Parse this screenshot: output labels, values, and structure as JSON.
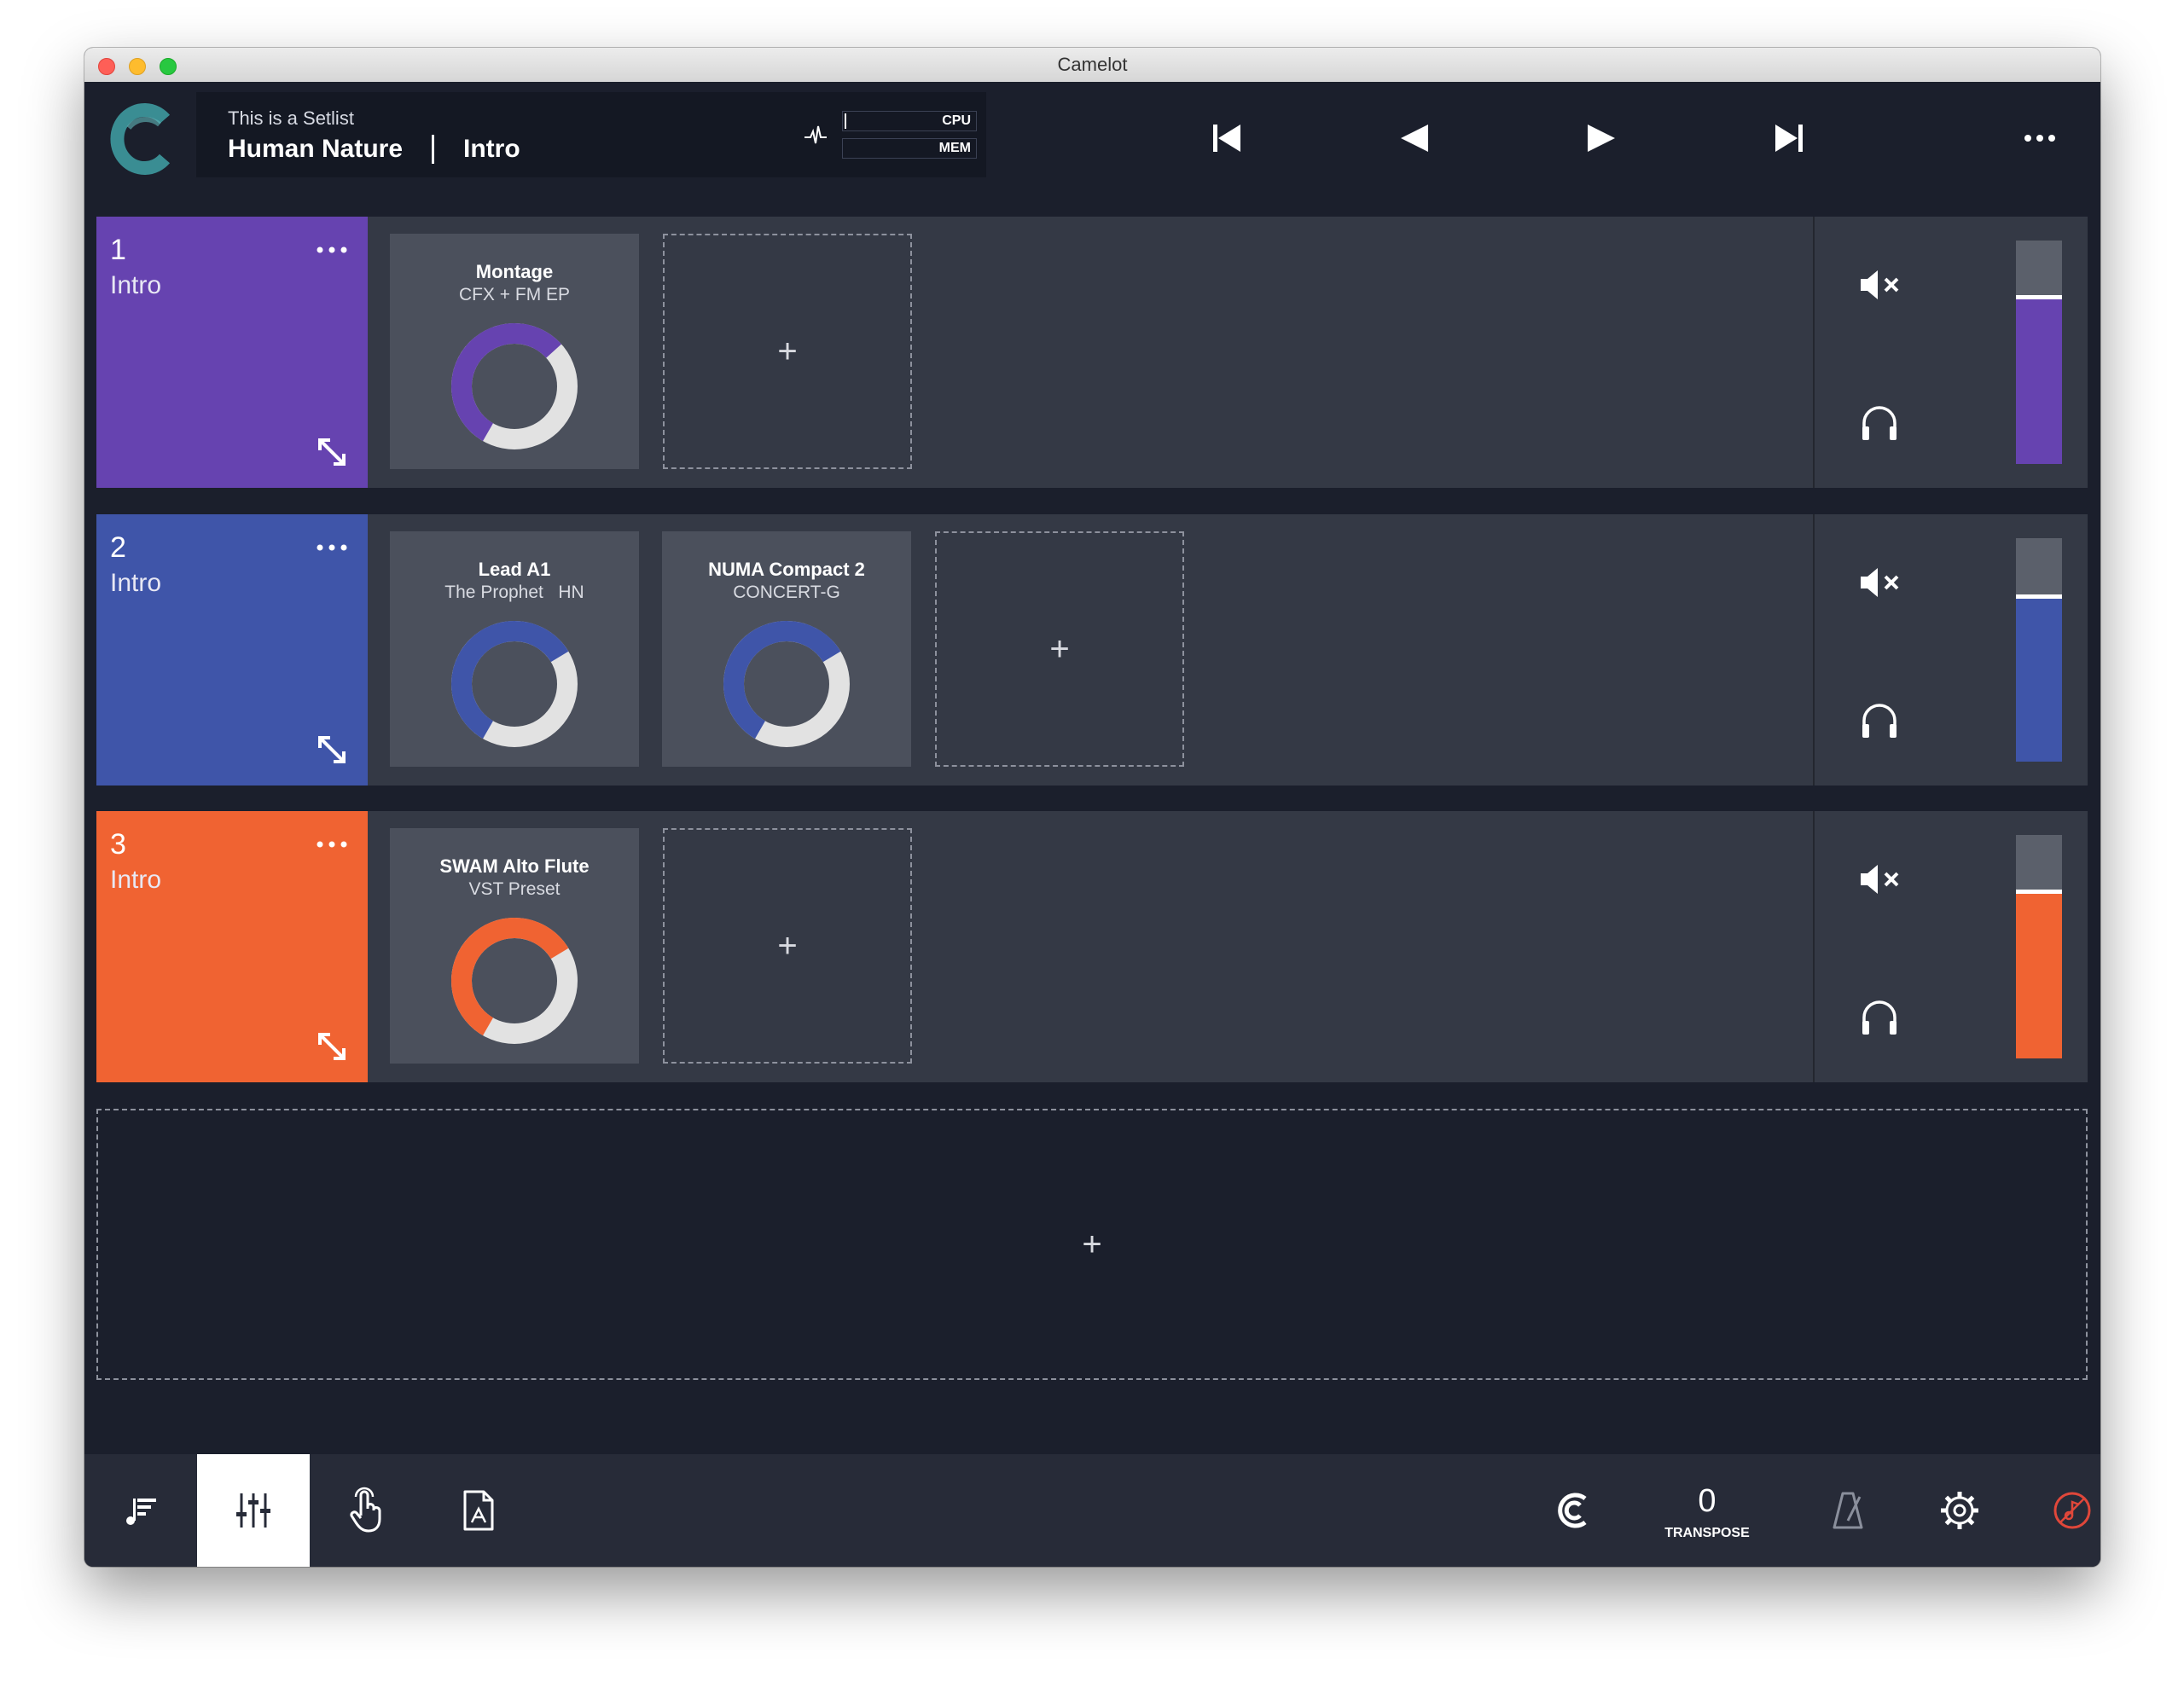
{
  "window": {
    "title": "Camelot"
  },
  "header": {
    "setlist_name": "This is a Setlist",
    "song_title": "Human Nature",
    "part_title": "Intro",
    "meters": {
      "cpu_label": "CPU",
      "mem_label": "MEM"
    }
  },
  "colors": {
    "background": "#1b1f2c",
    "row": "#343945",
    "tile": "#4b505c",
    "ring_track": "#e2e2e2",
    "logo": "#3a8d93",
    "part1": "#6643b0",
    "part2": "#3f55a9",
    "part3": "#f06332",
    "record": "#e0473a"
  },
  "parts": [
    {
      "number": "1",
      "name": "Intro",
      "color": "#6643b0",
      "volume_fraction": 0.75,
      "layers": [
        {
          "name": "Montage",
          "subtitle": "CFX + FM EP",
          "level": 0.55
        }
      ]
    },
    {
      "number": "2",
      "name": "Intro",
      "color": "#3f55a9",
      "volume_fraction": 0.74,
      "layers": [
        {
          "name": "Lead A1",
          "subtitle": "The Prophet   HN",
          "level": 0.58
        },
        {
          "name": "NUMA Compact 2",
          "subtitle": "CONCERT-G",
          "level": 0.58
        }
      ]
    },
    {
      "number": "3",
      "name": "Intro",
      "color": "#f06332",
      "volume_fraction": 0.75,
      "layers": [
        {
          "name": "SWAM Alto Flute",
          "subtitle": "VST Preset",
          "level": 0.58
        }
      ]
    }
  ],
  "add_symbol": "+",
  "bottom_bar": {
    "transpose_value": "0",
    "transpose_label": "TRANSPOSE"
  },
  "icons": {
    "transport": [
      "skip-back-icon",
      "previous-icon",
      "play-icon",
      "skip-forward-icon"
    ],
    "bottom_left": [
      "setlist-icon",
      "mixer-icon",
      "touch-icon",
      "pdf-icon"
    ],
    "bottom_right": [
      "camelot-sync-icon",
      "metronome-icon",
      "gear-icon",
      "record-icon"
    ]
  }
}
